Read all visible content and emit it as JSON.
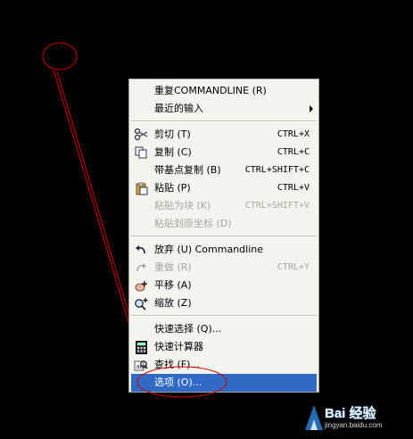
{
  "menu": {
    "items": [
      {
        "label": "重复COMMANDLINE (R)",
        "shortcut": "",
        "icon": "",
        "submenu": false,
        "disabled": false,
        "selected": false
      },
      {
        "label": "最近的输入",
        "shortcut": "",
        "icon": "",
        "submenu": true,
        "disabled": false,
        "selected": false
      },
      {
        "label": "剪切 (T)",
        "shortcut": "CTRL+X",
        "icon": "scissors-icon",
        "submenu": false,
        "disabled": false,
        "selected": false
      },
      {
        "label": "复制 (C)",
        "shortcut": "CTRL+C",
        "icon": "copy-icon",
        "submenu": false,
        "disabled": false,
        "selected": false
      },
      {
        "label": "带基点复制 (B)",
        "shortcut": "CTRL+SHIFT+C",
        "icon": "",
        "submenu": false,
        "disabled": false,
        "selected": false
      },
      {
        "label": "粘贴 (P)",
        "shortcut": "CTRL+V",
        "icon": "paste-icon",
        "submenu": false,
        "disabled": false,
        "selected": false
      },
      {
        "label": "粘贴为块 (K)",
        "shortcut": "CTRL+SHIFT+V",
        "icon": "",
        "submenu": false,
        "disabled": true,
        "selected": false
      },
      {
        "label": "粘贴到原坐标 (D)",
        "shortcut": "",
        "icon": "",
        "submenu": false,
        "disabled": true,
        "selected": false
      },
      {
        "label": "放弃 (U) Commandline",
        "shortcut": "",
        "icon": "undo-icon",
        "submenu": false,
        "disabled": false,
        "selected": false
      },
      {
        "label": "重做 (R)",
        "shortcut": "CTRL+Y",
        "icon": "redo-icon",
        "submenu": false,
        "disabled": true,
        "selected": false
      },
      {
        "label": "平移 (A)",
        "shortcut": "",
        "icon": "pan-icon",
        "submenu": false,
        "disabled": false,
        "selected": false
      },
      {
        "label": "缩放 (Z)",
        "shortcut": "",
        "icon": "zoom-icon",
        "submenu": false,
        "disabled": false,
        "selected": false
      },
      {
        "label": "快速选择 (Q)...",
        "shortcut": "",
        "icon": "",
        "submenu": false,
        "disabled": false,
        "selected": false
      },
      {
        "label": "快速计算器",
        "shortcut": "",
        "icon": "calculator-icon",
        "submenu": false,
        "disabled": false,
        "selected": false
      },
      {
        "label": "查找 (F)...",
        "shortcut": "",
        "icon": "find-icon",
        "submenu": false,
        "disabled": false,
        "selected": false
      },
      {
        "label": "选项 (O)...",
        "shortcut": "",
        "icon": "",
        "submenu": false,
        "disabled": false,
        "selected": true
      }
    ]
  },
  "colors": {
    "annotation": "#d40000",
    "selection": "#316ac5",
    "menu_bg": "#f4f3ee"
  },
  "watermark": {
    "text": "Bai 经验",
    "url_text": "jingyan.baidu.com"
  }
}
